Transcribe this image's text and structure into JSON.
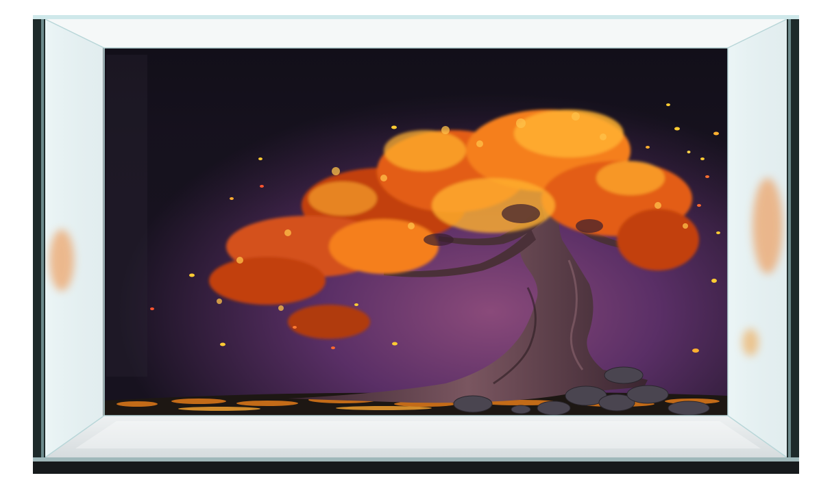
{
  "scene": {
    "subject": "bonsai-tree-in-glass-aquarium",
    "colors": {
      "page_background": "#ffffff",
      "backdrop_dark": "#17121f",
      "backdrop_purple": "#5a2f66",
      "backdrop_glow": "#8a4a7a",
      "foliage_light": "#ffb030",
      "foliage_mid": "#f57f1f",
      "foliage_dark": "#c2410c",
      "trunk": "#4a3038",
      "trunk_highlight": "#7a5660",
      "rock": "#4a4550",
      "ground": "#1d1713",
      "glass_edge": "#cfe8ea",
      "frame": "#1e2a2a"
    }
  }
}
